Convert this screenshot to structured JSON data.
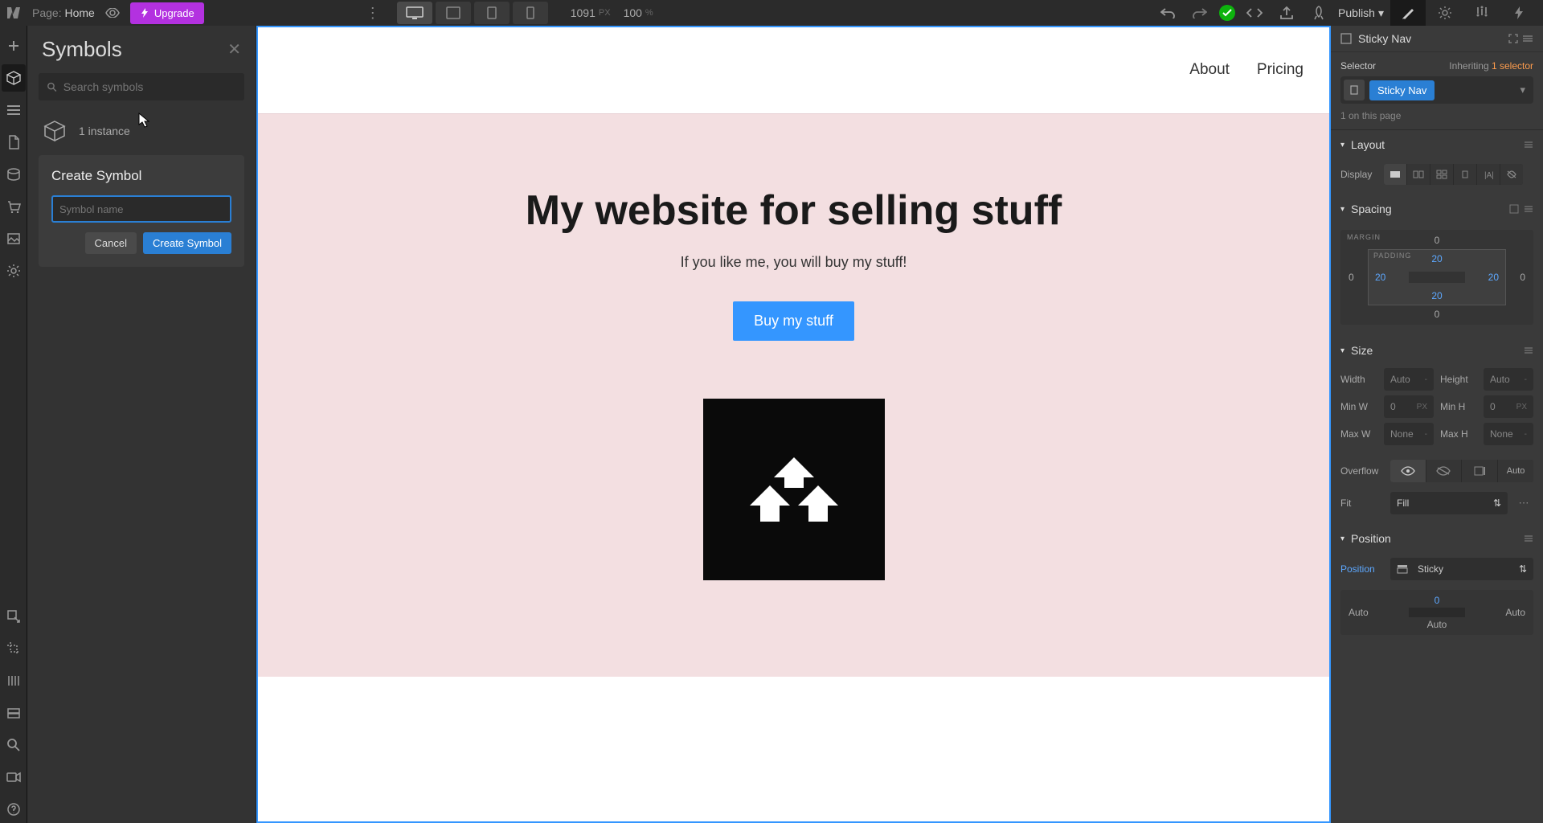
{
  "topbar": {
    "page_label": "Page:",
    "page_name": "Home",
    "upgrade": "Upgrade",
    "width": "1091",
    "width_unit": "PX",
    "zoom": "100",
    "zoom_unit": "%",
    "publish": "Publish"
  },
  "symbols": {
    "title": "Symbols",
    "search_placeholder": "Search symbols",
    "instance_count": "1 instance",
    "create_title": "Create Symbol",
    "name_placeholder": "Symbol name",
    "cancel": "Cancel",
    "create": "Create Symbol"
  },
  "canvas": {
    "nav": {
      "about": "About",
      "pricing": "Pricing"
    },
    "hero": {
      "title": "My website for selling stuff",
      "subtitle": "If you like me, you will buy my stuff!",
      "cta": "Buy my stuff"
    }
  },
  "style": {
    "element_name": "Sticky Nav",
    "selector_label": "Selector",
    "inheriting_label": "Inheriting",
    "inheriting_count": "1 selector",
    "selector_tag": "Sticky Nav",
    "on_page": "1 on this page",
    "sections": {
      "layout": "Layout",
      "spacing": "Spacing",
      "size": "Size",
      "position": "Position"
    },
    "display_label": "Display",
    "spacing": {
      "margin_label": "MARGIN",
      "padding_label": "PADDING",
      "margin": {
        "top": "0",
        "right": "0",
        "bottom": "0",
        "left": "0"
      },
      "padding": {
        "top": "20",
        "right": "20",
        "bottom": "20",
        "left": "20"
      }
    },
    "size": {
      "width_l": "Width",
      "width_v": "Auto",
      "width_u": "-",
      "height_l": "Height",
      "height_v": "Auto",
      "height_u": "-",
      "minw_l": "Min W",
      "minw_v": "0",
      "minw_u": "PX",
      "minh_l": "Min H",
      "minh_v": "0",
      "minh_u": "PX",
      "maxw_l": "Max W",
      "maxw_v": "None",
      "maxw_u": "-",
      "maxh_l": "Max H",
      "maxh_v": "None",
      "maxh_u": "-"
    },
    "overflow_label": "Overflow",
    "overflow_auto": "Auto",
    "fit_label": "Fit",
    "fit_value": "Fill",
    "position_label": "Position",
    "position_value": "Sticky",
    "position_offsets": {
      "top": "0",
      "right": "Auto",
      "bottom": "Auto",
      "left": "Auto"
    }
  }
}
